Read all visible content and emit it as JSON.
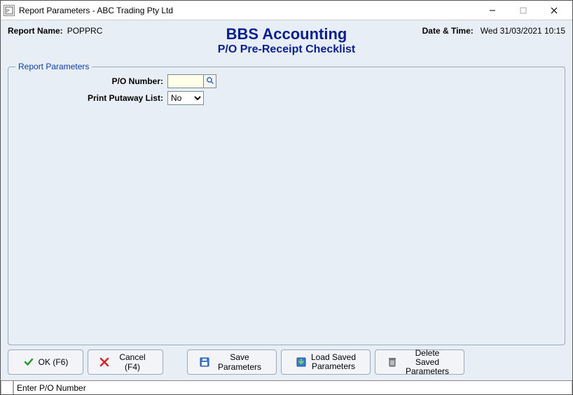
{
  "window": {
    "title": "Report Parameters - ABC Trading Pty Ltd"
  },
  "header": {
    "report_name_label": "Report Name:",
    "report_name_value": "POPPRC",
    "app_title": "BBS Accounting",
    "app_subtitle": "P/O Pre-Receipt Checklist",
    "datetime_label": "Date & Time:",
    "datetime_value": "Wed 31/03/2021 10:15"
  },
  "fieldset": {
    "legend": "Report Parameters",
    "po_number_label": "P/O Number:",
    "po_number_value": "",
    "print_putaway_label": "Print Putaway List:",
    "print_putaway_value": "No"
  },
  "buttons": {
    "ok": "OK (F6)",
    "cancel": "Cancel (F4)",
    "save_params": "Save Parameters",
    "load_saved_l1": "Load Saved",
    "load_saved_l2": "Parameters",
    "delete_saved_l1": "Delete Saved",
    "delete_saved_l2": "Parameters"
  },
  "statusbar": {
    "message": "Enter P/O Number"
  }
}
